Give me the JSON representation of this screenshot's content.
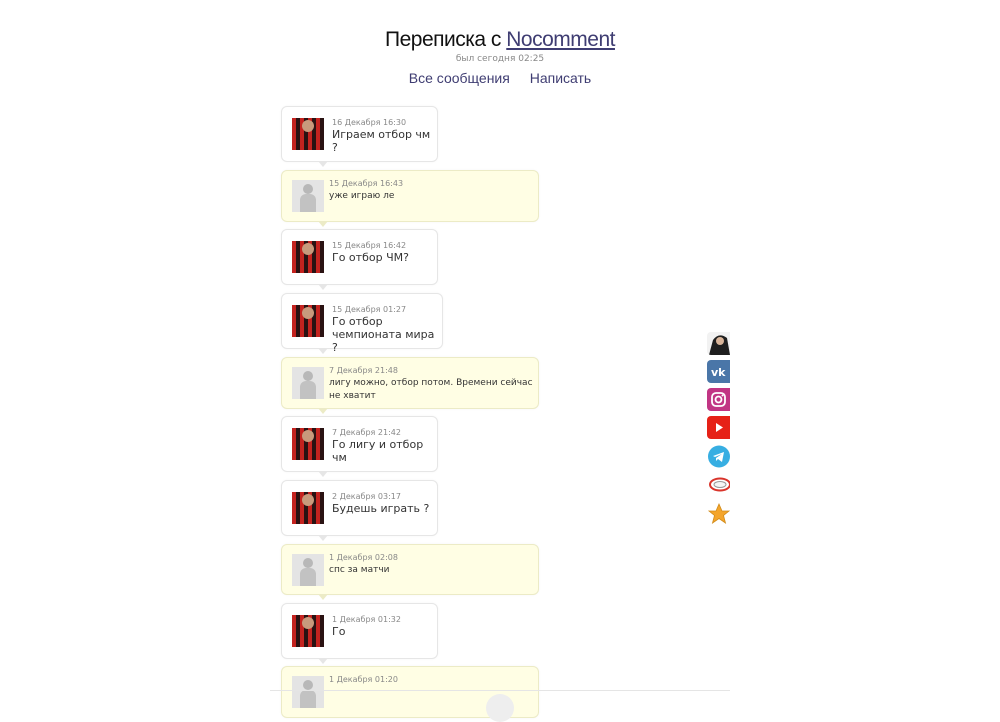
{
  "header": {
    "title_prefix": "Переписка с",
    "username": "Nocomment",
    "last_seen": "был сегодня 02:25",
    "nav": {
      "all_messages": "Все сообщения",
      "write": "Написать"
    }
  },
  "messages": [
    {
      "date": "16 Декабря 16:30",
      "text": "Играем отбор чм ?",
      "direction": "outgoing"
    },
    {
      "date": "15 Декабря 16:43",
      "text": "уже играю ле",
      "direction": "incoming"
    },
    {
      "date": "15 Декабря 16:42",
      "text": "Го отбор ЧМ?",
      "direction": "outgoing"
    },
    {
      "date": "15 Декабря 01:27",
      "text": "Го отбор чемпионата мира ?",
      "direction": "outgoing"
    },
    {
      "date": "7 Декабря 21:48",
      "text": "лигу можно, отбор потом. Времени сейчас не хватит",
      "direction": "incoming"
    },
    {
      "date": "7 Декабря 21:42",
      "text": "Го лигу и отбор чм",
      "direction": "outgoing"
    },
    {
      "date": "2 Декабря 03:17",
      "text": "Будешь играть ?",
      "direction": "outgoing"
    },
    {
      "date": "1 Декабря 02:08",
      "text": "спс за матчи",
      "direction": "incoming"
    },
    {
      "date": "1 Декабря 01:32",
      "text": "Го",
      "direction": "outgoing"
    },
    {
      "date": "1 Декабря 01:20",
      "text": "",
      "direction": "incoming"
    }
  ],
  "social": {
    "items": [
      {
        "icon": "profile-photo-icon",
        "color": "#1f1f1f"
      },
      {
        "icon": "vk-icon",
        "color": "#4a76a8"
      },
      {
        "icon": "instagram-icon",
        "color": "#c13584"
      },
      {
        "icon": "youtube-icon",
        "color": "#e62117"
      },
      {
        "icon": "telegram-icon",
        "color": "#37aee2"
      },
      {
        "icon": "logo-icon",
        "color": "#d9342b"
      },
      {
        "icon": "star-icon",
        "color": "#f4a52b"
      }
    ]
  }
}
